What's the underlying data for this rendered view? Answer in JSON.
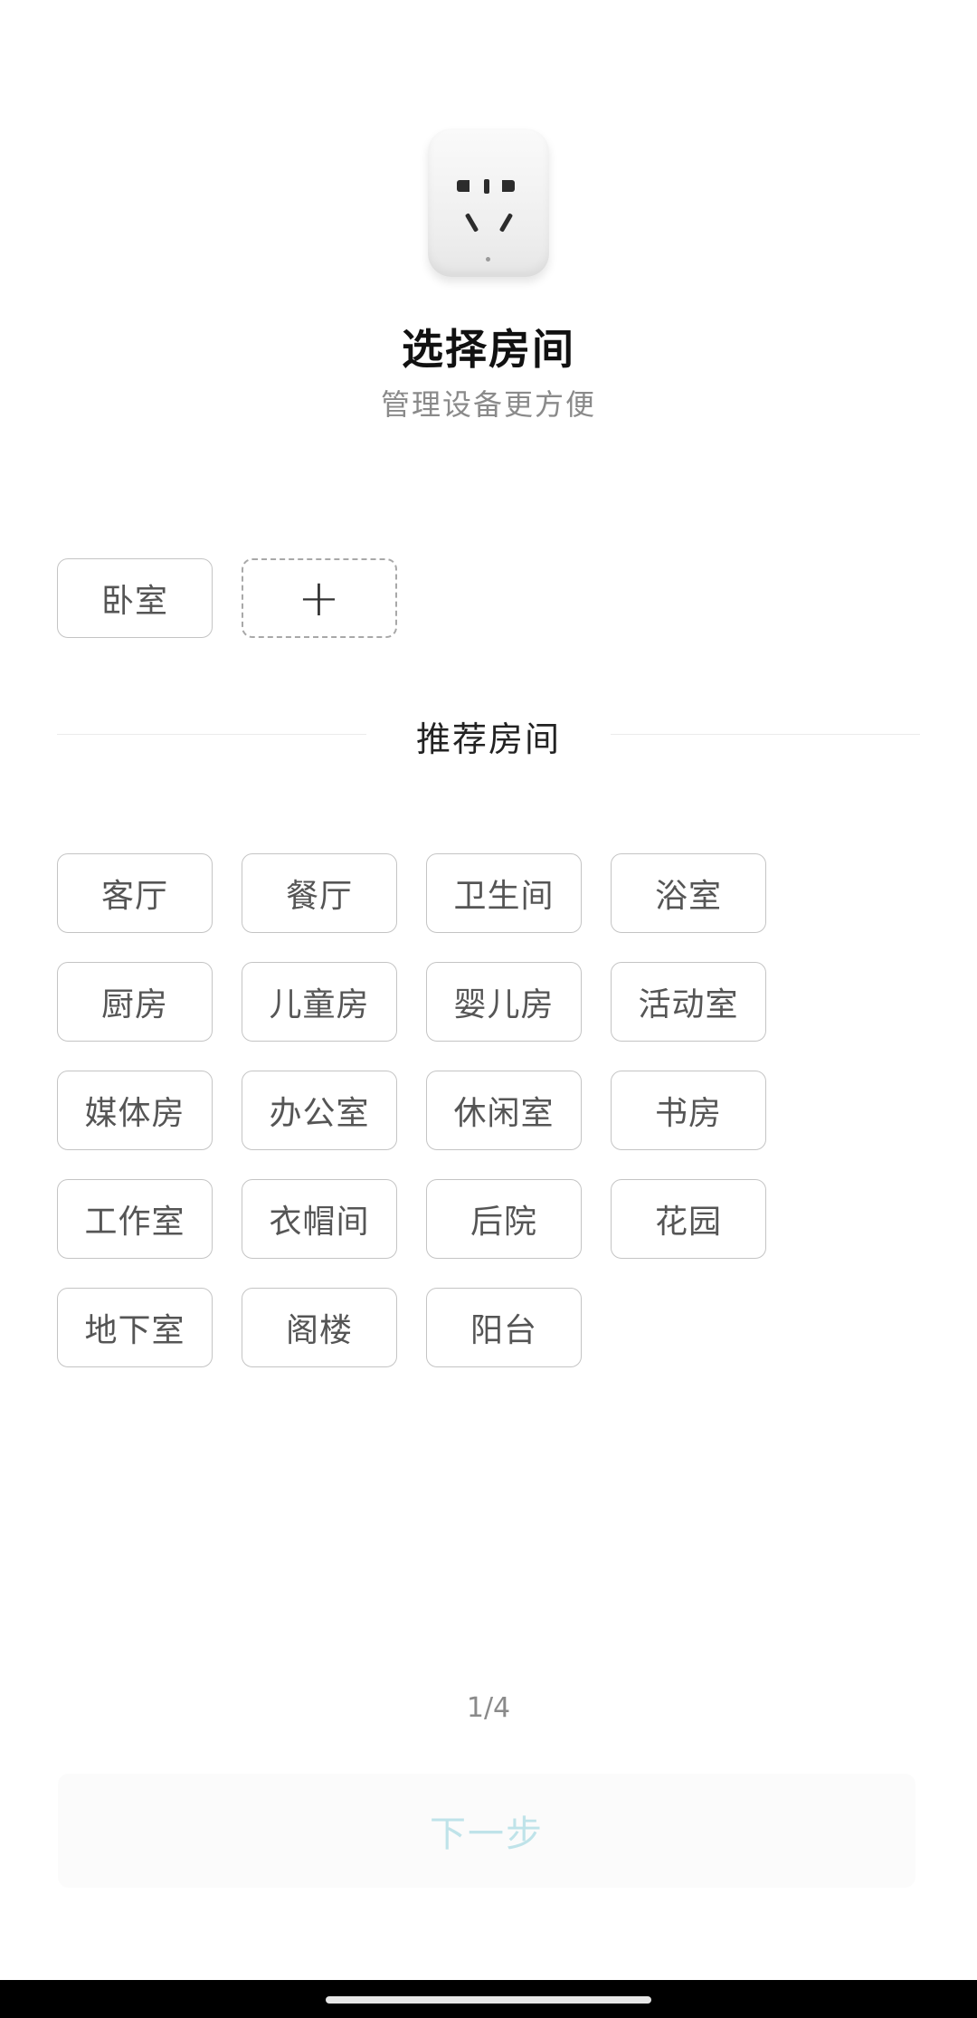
{
  "header": {
    "device_icon": "smart-plug",
    "title": "选择房间",
    "subtitle": "管理设备更方便"
  },
  "current_rooms": {
    "items": [
      "卧室"
    ],
    "add_icon": "plus-icon",
    "add_label": "+"
  },
  "recommended": {
    "section_label": "推荐房间",
    "rooms": [
      "客厅",
      "餐厅",
      "卫生间",
      "浴室",
      "厨房",
      "儿童房",
      "婴儿房",
      "活动室",
      "媒体房",
      "办公室",
      "休闲室",
      "书房",
      "工作室",
      "衣帽间",
      "后院",
      "花园",
      "地下室",
      "阁楼",
      "阳台"
    ]
  },
  "footer": {
    "page_indicator": "1/4",
    "next_label": "下一步"
  },
  "colors": {
    "chip_border": "#c4c4c4",
    "next_text": "#bfe3e9",
    "subtitle": "#8a8a8a"
  }
}
